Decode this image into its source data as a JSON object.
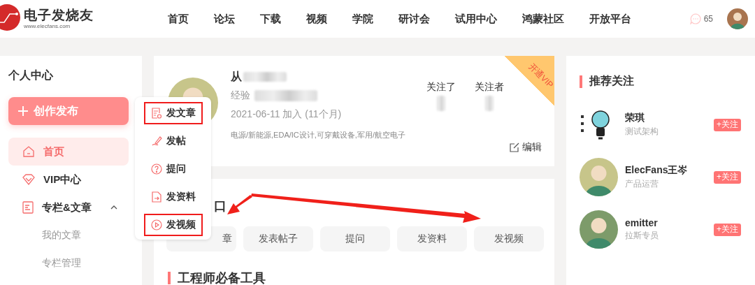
{
  "header": {
    "logo": {
      "title": "电子发烧友",
      "url": "www.elecfans.com"
    },
    "nav": [
      "首页",
      "论坛",
      "下载",
      "视频",
      "学院",
      "研讨会",
      "试用中心",
      "鸿蒙社区",
      "开放平台"
    ],
    "messages": {
      "count": "65"
    }
  },
  "sidebar": {
    "title": "个人中心",
    "create_button": "创作发布",
    "items": [
      {
        "label": "首页",
        "kind": "home",
        "selected": true
      },
      {
        "label": "VIP中心",
        "kind": "vip",
        "selected": false
      },
      {
        "label": "专栏&文章",
        "kind": "column",
        "selected": false,
        "expanded": true,
        "children": [
          {
            "label": "我的文章"
          },
          {
            "label": "专栏管理"
          }
        ]
      }
    ]
  },
  "popup_menu": {
    "items": [
      {
        "label": "发文章",
        "kind": "article",
        "highlighted": true
      },
      {
        "label": "发帖",
        "kind": "post",
        "highlighted": false
      },
      {
        "label": "提问",
        "kind": "question",
        "highlighted": false
      },
      {
        "label": "发资料",
        "kind": "file",
        "highlighted": false
      },
      {
        "label": "发视频",
        "kind": "video",
        "highlighted": true
      }
    ]
  },
  "profile": {
    "name": "从",
    "experience_label": "经验",
    "joined": "2021-06-11 加入 (11个月)",
    "tags": "电源/新能源,EDA/IC设计,可穿戴设备,军用/航空电子",
    "stats": [
      "关注了",
      "关注者"
    ],
    "edit": "编辑",
    "vip_ribbon": "开通VIP"
  },
  "quick_entry": {
    "title": "口",
    "buttons": [
      "章",
      "发表帖子",
      "提问",
      "发资料",
      "发视频"
    ]
  },
  "tools": {
    "title": "工程师必备工具"
  },
  "recommend": {
    "title": "推荐关注",
    "users": [
      {
        "name": "荣琪",
        "role": "测试架构",
        "follow": "+关注"
      },
      {
        "name": "ElecFans王岑",
        "role": "产品运营",
        "follow": "+关注"
      },
      {
        "name": "emitter",
        "role": "拉斯专员",
        "follow": "+关注"
      }
    ]
  }
}
